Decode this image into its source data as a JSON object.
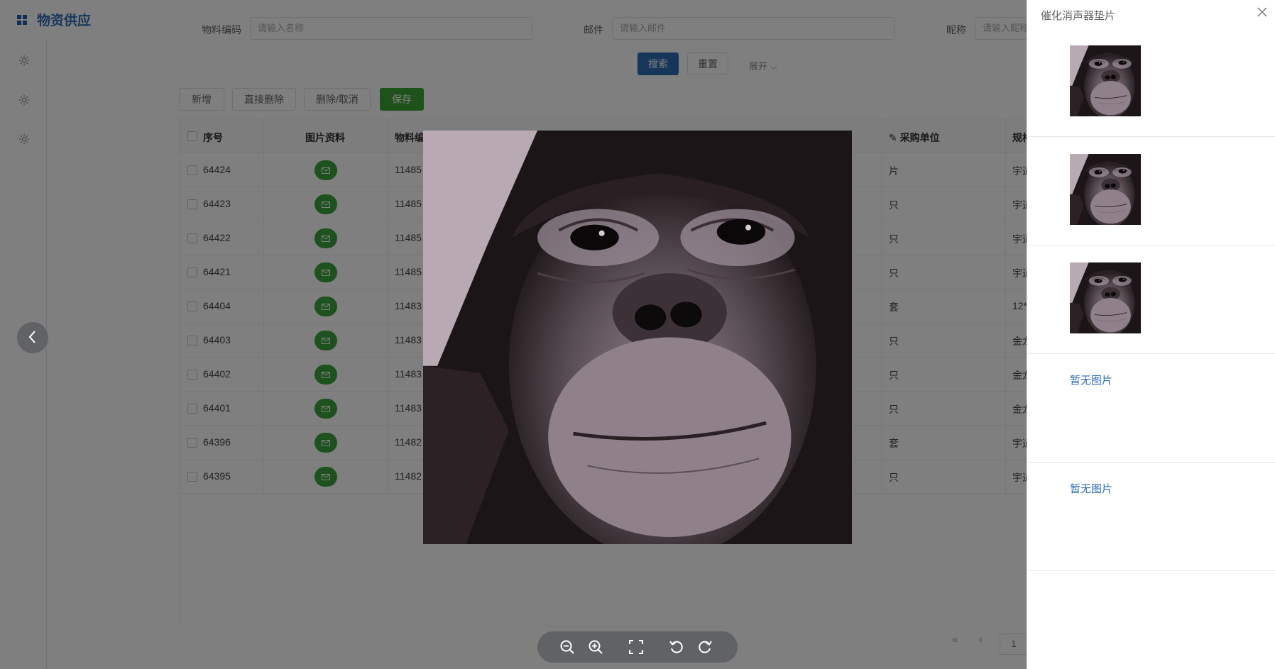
{
  "app": {
    "title": "物资供应"
  },
  "filters": [
    {
      "label": "物料编码",
      "placeholder": "请输入名称"
    },
    {
      "label": "邮件",
      "placeholder": "请输入邮件"
    },
    {
      "label": "昵称",
      "placeholder": "请输入昵称"
    }
  ],
  "actions": {
    "search": "搜索",
    "reset": "重置",
    "expand": "展开",
    "add": "新增",
    "direct_delete": "直接删除",
    "delete_cancel": "删除/取消",
    "save": "保存"
  },
  "table": {
    "headers": [
      "序号",
      "图片资料",
      "物料编",
      "采购单位",
      "规格"
    ],
    "rows": [
      {
        "id": "64424",
        "code": "11485",
        "unit": "片",
        "spec": "宇通"
      },
      {
        "id": "64423",
        "code": "11485",
        "unit": "只",
        "spec": "宇通"
      },
      {
        "id": "64422",
        "code": "11485",
        "unit": "只",
        "spec": "宇通"
      },
      {
        "id": "64421",
        "code": "11485",
        "unit": "只",
        "spec": "宇通"
      },
      {
        "id": "64404",
        "code": "11483",
        "unit": "套",
        "spec": "12*"
      },
      {
        "id": "64403",
        "code": "11483",
        "unit": "只",
        "spec": "金龙"
      },
      {
        "id": "64402",
        "code": "11483",
        "unit": "只",
        "spec": "金龙"
      },
      {
        "id": "64401",
        "code": "11483",
        "unit": "只",
        "spec": "金龙"
      },
      {
        "id": "64396",
        "code": "11482",
        "unit": "套",
        "spec": "宇通"
      },
      {
        "id": "64395",
        "code": "11482",
        "unit": "只",
        "spec": "宇通"
      }
    ]
  },
  "pagination": {
    "current_page": "1"
  },
  "drawer": {
    "title": "催化消声器垫片",
    "empty_text": "暂无图片"
  },
  "colors": {
    "brand": "#2f6db5",
    "success": "#3ca437",
    "overlay": "rgba(0,0,0,0.5)"
  }
}
